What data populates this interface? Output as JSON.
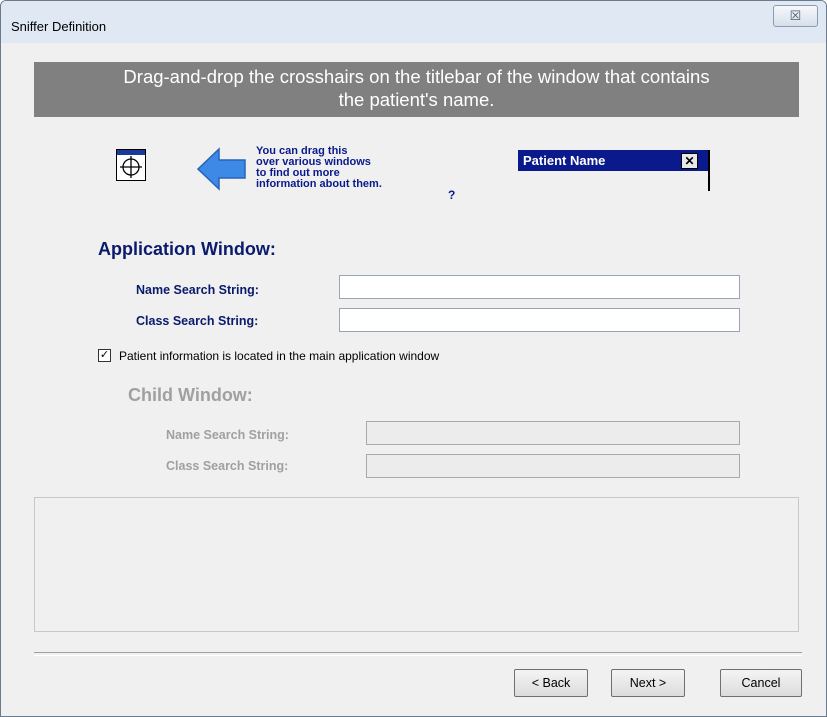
{
  "window": {
    "title": "Sniffer Definition",
    "close_label": "☒"
  },
  "banner": {
    "line1": "Drag-and-drop the crosshairs on the titlebar of the window that contains",
    "line2": "the patient's name."
  },
  "hint": {
    "text": "You can drag this\nover various windows\nto find out more\ninformation about them.",
    "help_icon": "?"
  },
  "preview": {
    "title": "Patient Name",
    "close_label": "✕"
  },
  "application": {
    "title": "Application Window:",
    "name_label": "Name Search String:",
    "name_value": "",
    "class_label": "Class Search String:",
    "class_value": ""
  },
  "checkbox": {
    "checked": true,
    "mark": "✓",
    "label": "Patient information is located in the main application window"
  },
  "child": {
    "title": "Child Window:",
    "name_label": "Name Search String:",
    "name_value": "",
    "class_label": "Class Search String:",
    "class_value": ""
  },
  "buttons": {
    "back": "< Back",
    "next": "Next >",
    "cancel": "Cancel"
  },
  "colors": {
    "banner": "#808080",
    "accent": "#0a1a8c",
    "arrow": "#3c8ae6",
    "disabled": "#a0a0a0"
  },
  "icons": {
    "crosshair": "crosshair-icon",
    "arrow": "arrow-left-icon",
    "help": "help-icon"
  }
}
